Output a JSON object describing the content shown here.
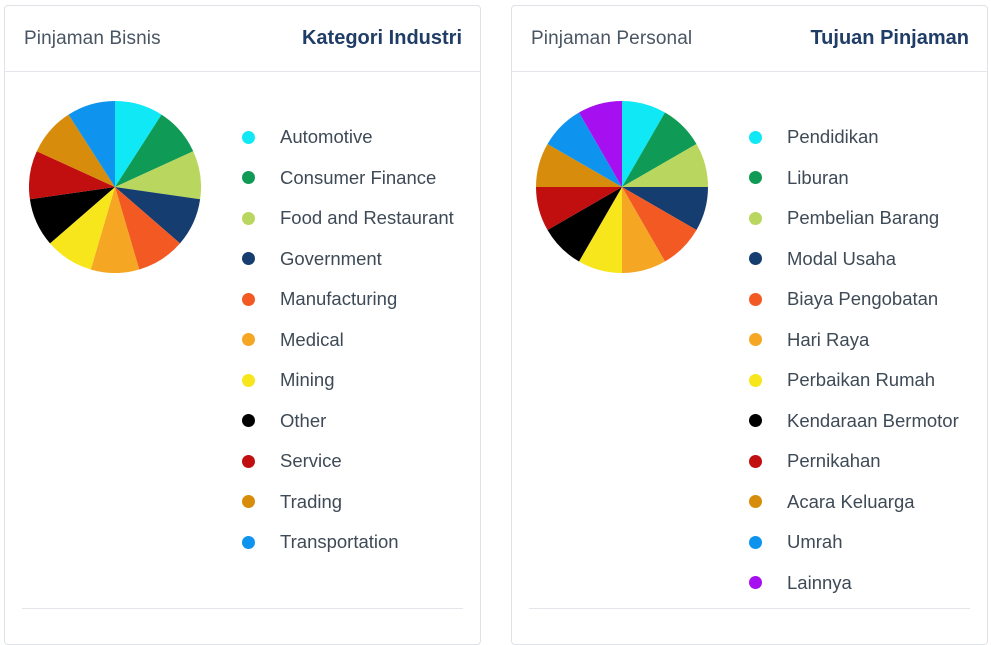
{
  "chart_data": [
    {
      "type": "pie",
      "title": "Pinjaman Bisnis",
      "subtitle": "Kategori Industri",
      "categories": [
        "Automotive",
        "Consumer Finance",
        "Food and Restaurant",
        "Government",
        "Manufacturing",
        "Medical",
        "Mining",
        "Other",
        "Service",
        "Trading",
        "Transportation"
      ],
      "values": [
        1,
        1,
        1,
        1,
        1,
        1,
        1,
        1,
        1,
        1,
        1
      ],
      "colors": [
        "#10e8f5",
        "#0f9a55",
        "#b9d75e",
        "#153d70",
        "#f35a23",
        "#f5a623",
        "#f8e61d",
        "#000000",
        "#c10f0f",
        "#d88c0b",
        "#0e94ef"
      ],
      "legend_position": "right"
    },
    {
      "type": "pie",
      "title": "Pinjaman Personal",
      "subtitle": "Tujuan Pinjaman",
      "categories": [
        "Pendidikan",
        "Liburan",
        "Pembelian Barang",
        "Modal Usaha",
        "Biaya Pengobatan",
        "Hari Raya",
        "Perbaikan Rumah",
        "Kendaraan Bermotor",
        "Pernikahan",
        "Acara Keluarga",
        "Umrah",
        "Lainnya"
      ],
      "values": [
        1,
        1,
        1,
        1,
        1,
        1,
        1,
        1,
        1,
        1,
        1,
        1
      ],
      "colors": [
        "#10e8f5",
        "#0f9a55",
        "#b9d75e",
        "#153d70",
        "#f35a23",
        "#f5a623",
        "#f8e61d",
        "#000000",
        "#c10f0f",
        "#d88c0b",
        "#0e94ef",
        "#a60fef"
      ],
      "legend_position": "right"
    }
  ]
}
